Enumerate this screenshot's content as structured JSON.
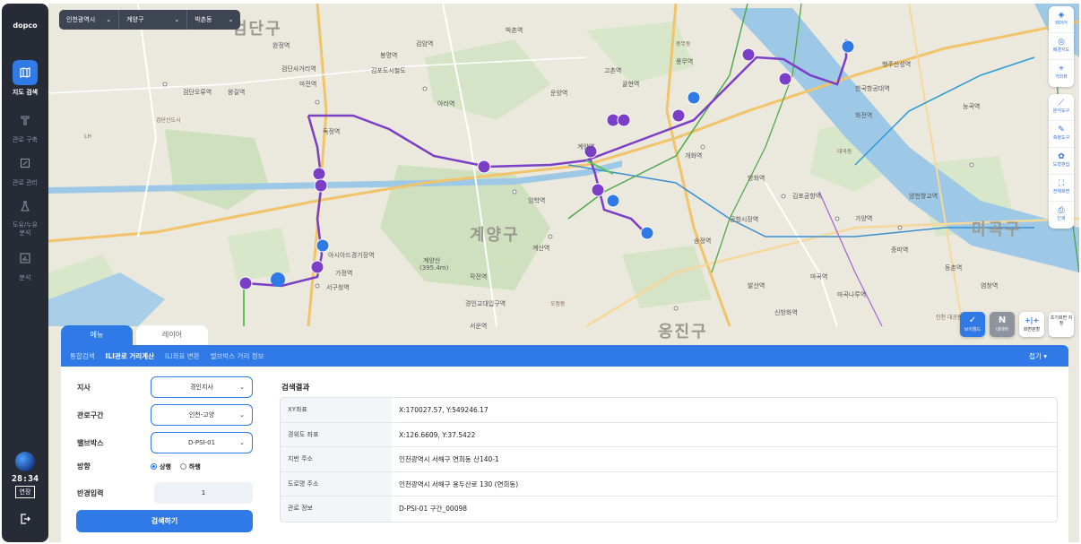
{
  "sidebar": {
    "logo": "dopco",
    "items": [
      {
        "label": "지도 검색",
        "icon": "map-icon",
        "active": true
      },
      {
        "label": "관로 구축",
        "icon": "pipe-icon",
        "active": false
      },
      {
        "label": "관로 관리",
        "icon": "edit-icon",
        "active": false
      },
      {
        "label": "도유/누유 분석",
        "icon": "flask-icon",
        "active": false
      },
      {
        "label": "분석",
        "icon": "chart-icon",
        "active": false
      }
    ],
    "timer": "28:34",
    "extend_label": "연장"
  },
  "region": {
    "city": "인천광역시",
    "district": "계양구",
    "dong": "박촌동"
  },
  "map": {
    "big_labels": [
      "검단구",
      "계양구",
      "마곡구",
      "옹진구"
    ],
    "labels": [
      "검단사거리역",
      "검단오류역",
      "왕길역",
      "마전역",
      "독정역",
      "아라역",
      "계양역",
      "귤현역",
      "박촌역",
      "임학역",
      "계산역",
      "경인교대입구역",
      "작전역",
      "서운역",
      "가정역",
      "서구청역",
      "아시아드경기장역",
      "김포공항역",
      "개화역",
      "송정역",
      "마곡역",
      "발산역",
      "공항시장역",
      "방화역",
      "고촌역",
      "한국항공대역",
      "행주산성역",
      "화전역",
      "양천향교역",
      "가양역",
      "증미역",
      "등촌역",
      "염창역",
      "신방화역",
      "마곡나루역",
      "계양산",
      "(395.4m)",
      "봉명역",
      "김포도시철도",
      "검암역",
      "완정역",
      "능곡역",
      "풍무역",
      "운양역"
    ],
    "pois": [
      "검단신도시",
      "대곡동",
      "풍무동",
      "오정동",
      "LH",
      "인천 대공원"
    ]
  },
  "right_tools": [
    {
      "icon": "layers-icon",
      "label": "레이어"
    },
    {
      "icon": "base-map-icon",
      "label": "배경지도"
    },
    {
      "icon": "location-icon",
      "label": "거리뷰"
    },
    {
      "icon": "analysis-icon",
      "label": "분석도구"
    },
    {
      "icon": "measure-icon",
      "label": "측정도구"
    },
    {
      "icon": "draw-icon",
      "label": "도형편집"
    },
    {
      "icon": "fullscreen-icon",
      "label": "전체화면"
    },
    {
      "icon": "print-icon",
      "label": "인쇄"
    }
  ],
  "bottom_tools": [
    {
      "glyph": "✓",
      "label": "브이월드"
    },
    {
      "glyph": "N",
      "label": "네이버"
    },
    {
      "glyph": "+|+",
      "label": "화면분할"
    },
    {
      "glyph": "",
      "label": "초기화면 지정"
    }
  ],
  "panel": {
    "tabs": [
      "메뉴",
      "레이어"
    ],
    "subnav": [
      "통합검색",
      "ILI관로 거리계산",
      "ILI좌표 변환",
      "밸브박스 거리 정보"
    ],
    "collapse": "접기",
    "form": {
      "branch_label": "지사",
      "branch_value": "경인지사",
      "section_label": "관로구간",
      "section_value": "인천-고양",
      "valve_label": "밸브박스",
      "valve_value": "D-PSI-01",
      "direction_label": "방향",
      "dir_up": "상행",
      "dir_down": "하행",
      "radius_label": "반경입력",
      "radius_value": "1",
      "search_button": "검색하기"
    },
    "result_title": "검색결과",
    "results": [
      {
        "key": "XY좌표",
        "value": "X:170027.57, Y:549246.17"
      },
      {
        "key": "경위도 좌표",
        "value": "X:126.6609, Y:37.5422"
      },
      {
        "key": "지번 주소",
        "value": "인천광역시 서해구 연희동 산140-1"
      },
      {
        "key": "도로명 주소",
        "value": "인천광역시 서해구 용두산로 130 (연희동)"
      },
      {
        "key": "관로 정보",
        "value": "D-PSI-01 구간_00098"
      }
    ]
  },
  "colors": {
    "accent": "#2f7ae6",
    "sidebar": "#262b36",
    "pipeline": "#7b3fc7",
    "river": "#9ec9e6"
  }
}
